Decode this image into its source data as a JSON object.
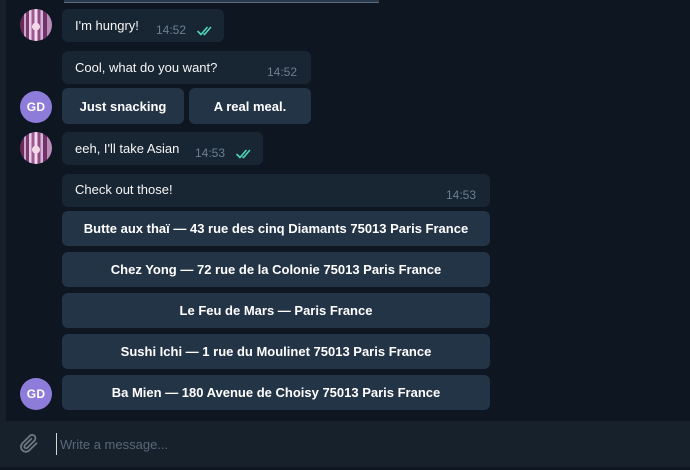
{
  "colors": {
    "background": "#0e1621",
    "bubble": "#182533",
    "bot_button": "#243447",
    "composer": "#17212b",
    "read_check": "#4fd6b6",
    "timestamp": "#6d7f8f",
    "avatar_initials_bg": "#8e7cdb"
  },
  "messages": [
    {
      "author": "user",
      "text": "I'm hungry!",
      "time": "14:52",
      "status_icon": "double-check-icon"
    },
    {
      "author": "bot",
      "text": "Cool, what do you want?",
      "time": "14:52"
    },
    {
      "author": "user",
      "text": "eeh, I'll take Asian",
      "time": "14:53",
      "status_icon": "double-check-icon"
    },
    {
      "author": "bot",
      "text": "Check out those!",
      "time": "14:53"
    }
  ],
  "bot": {
    "avatar_initials": "GD"
  },
  "keyboard_1": {
    "buttons": [
      "Just snacking",
      "A real meal."
    ]
  },
  "keyboard_2": {
    "buttons": [
      "Butte aux thaï — 43 rue des cinq Diamants 75013 Paris France",
      "Chez Yong — 72 rue de la Colonie 75013 Paris France",
      "Le Feu de Mars — Paris France",
      "Sushi Ichi — 1 rue du Moulinet 75013 Paris France",
      "Ba Mien — 180 Avenue de Choisy 75013 Paris France"
    ]
  },
  "composer": {
    "placeholder": "Write a message...",
    "attach_icon": "paperclip-icon"
  }
}
